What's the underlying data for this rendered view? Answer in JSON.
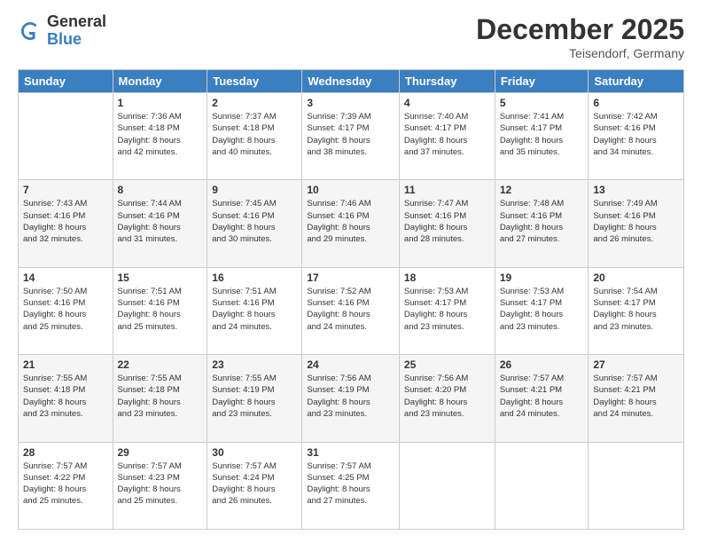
{
  "logo": {
    "general": "General",
    "blue": "Blue"
  },
  "header": {
    "month": "December 2025",
    "location": "Teisendorf, Germany"
  },
  "weekdays": [
    "Sunday",
    "Monday",
    "Tuesday",
    "Wednesday",
    "Thursday",
    "Friday",
    "Saturday"
  ],
  "weeks": [
    [
      {
        "day": "",
        "sunrise": "",
        "sunset": "",
        "daylight": ""
      },
      {
        "day": "1",
        "sunrise": "Sunrise: 7:36 AM",
        "sunset": "Sunset: 4:18 PM",
        "daylight": "Daylight: 8 hours and 42 minutes."
      },
      {
        "day": "2",
        "sunrise": "Sunrise: 7:37 AM",
        "sunset": "Sunset: 4:18 PM",
        "daylight": "Daylight: 8 hours and 40 minutes."
      },
      {
        "day": "3",
        "sunrise": "Sunrise: 7:39 AM",
        "sunset": "Sunset: 4:17 PM",
        "daylight": "Daylight: 8 hours and 38 minutes."
      },
      {
        "day": "4",
        "sunrise": "Sunrise: 7:40 AM",
        "sunset": "Sunset: 4:17 PM",
        "daylight": "Daylight: 8 hours and 37 minutes."
      },
      {
        "day": "5",
        "sunrise": "Sunrise: 7:41 AM",
        "sunset": "Sunset: 4:17 PM",
        "daylight": "Daylight: 8 hours and 35 minutes."
      },
      {
        "day": "6",
        "sunrise": "Sunrise: 7:42 AM",
        "sunset": "Sunset: 4:16 PM",
        "daylight": "Daylight: 8 hours and 34 minutes."
      }
    ],
    [
      {
        "day": "7",
        "sunrise": "Sunrise: 7:43 AM",
        "sunset": "Sunset: 4:16 PM",
        "daylight": "Daylight: 8 hours and 32 minutes."
      },
      {
        "day": "8",
        "sunrise": "Sunrise: 7:44 AM",
        "sunset": "Sunset: 4:16 PM",
        "daylight": "Daylight: 8 hours and 31 minutes."
      },
      {
        "day": "9",
        "sunrise": "Sunrise: 7:45 AM",
        "sunset": "Sunset: 4:16 PM",
        "daylight": "Daylight: 8 hours and 30 minutes."
      },
      {
        "day": "10",
        "sunrise": "Sunrise: 7:46 AM",
        "sunset": "Sunset: 4:16 PM",
        "daylight": "Daylight: 8 hours and 29 minutes."
      },
      {
        "day": "11",
        "sunrise": "Sunrise: 7:47 AM",
        "sunset": "Sunset: 4:16 PM",
        "daylight": "Daylight: 8 hours and 28 minutes."
      },
      {
        "day": "12",
        "sunrise": "Sunrise: 7:48 AM",
        "sunset": "Sunset: 4:16 PM",
        "daylight": "Daylight: 8 hours and 27 minutes."
      },
      {
        "day": "13",
        "sunrise": "Sunrise: 7:49 AM",
        "sunset": "Sunset: 4:16 PM",
        "daylight": "Daylight: 8 hours and 26 minutes."
      }
    ],
    [
      {
        "day": "14",
        "sunrise": "Sunrise: 7:50 AM",
        "sunset": "Sunset: 4:16 PM",
        "daylight": "Daylight: 8 hours and 25 minutes."
      },
      {
        "day": "15",
        "sunrise": "Sunrise: 7:51 AM",
        "sunset": "Sunset: 4:16 PM",
        "daylight": "Daylight: 8 hours and 25 minutes."
      },
      {
        "day": "16",
        "sunrise": "Sunrise: 7:51 AM",
        "sunset": "Sunset: 4:16 PM",
        "daylight": "Daylight: 8 hours and 24 minutes."
      },
      {
        "day": "17",
        "sunrise": "Sunrise: 7:52 AM",
        "sunset": "Sunset: 4:16 PM",
        "daylight": "Daylight: 8 hours and 24 minutes."
      },
      {
        "day": "18",
        "sunrise": "Sunrise: 7:53 AM",
        "sunset": "Sunset: 4:17 PM",
        "daylight": "Daylight: 8 hours and 23 minutes."
      },
      {
        "day": "19",
        "sunrise": "Sunrise: 7:53 AM",
        "sunset": "Sunset: 4:17 PM",
        "daylight": "Daylight: 8 hours and 23 minutes."
      },
      {
        "day": "20",
        "sunrise": "Sunrise: 7:54 AM",
        "sunset": "Sunset: 4:17 PM",
        "daylight": "Daylight: 8 hours and 23 minutes."
      }
    ],
    [
      {
        "day": "21",
        "sunrise": "Sunrise: 7:55 AM",
        "sunset": "Sunset: 4:18 PM",
        "daylight": "Daylight: 8 hours and 23 minutes."
      },
      {
        "day": "22",
        "sunrise": "Sunrise: 7:55 AM",
        "sunset": "Sunset: 4:18 PM",
        "daylight": "Daylight: 8 hours and 23 minutes."
      },
      {
        "day": "23",
        "sunrise": "Sunrise: 7:55 AM",
        "sunset": "Sunset: 4:19 PM",
        "daylight": "Daylight: 8 hours and 23 minutes."
      },
      {
        "day": "24",
        "sunrise": "Sunrise: 7:56 AM",
        "sunset": "Sunset: 4:19 PM",
        "daylight": "Daylight: 8 hours and 23 minutes."
      },
      {
        "day": "25",
        "sunrise": "Sunrise: 7:56 AM",
        "sunset": "Sunset: 4:20 PM",
        "daylight": "Daylight: 8 hours and 23 minutes."
      },
      {
        "day": "26",
        "sunrise": "Sunrise: 7:57 AM",
        "sunset": "Sunset: 4:21 PM",
        "daylight": "Daylight: 8 hours and 24 minutes."
      },
      {
        "day": "27",
        "sunrise": "Sunrise: 7:57 AM",
        "sunset": "Sunset: 4:21 PM",
        "daylight": "Daylight: 8 hours and 24 minutes."
      }
    ],
    [
      {
        "day": "28",
        "sunrise": "Sunrise: 7:57 AM",
        "sunset": "Sunset: 4:22 PM",
        "daylight": "Daylight: 8 hours and 25 minutes."
      },
      {
        "day": "29",
        "sunrise": "Sunrise: 7:57 AM",
        "sunset": "Sunset: 4:23 PM",
        "daylight": "Daylight: 8 hours and 25 minutes."
      },
      {
        "day": "30",
        "sunrise": "Sunrise: 7:57 AM",
        "sunset": "Sunset: 4:24 PM",
        "daylight": "Daylight: 8 hours and 26 minutes."
      },
      {
        "day": "31",
        "sunrise": "Sunrise: 7:57 AM",
        "sunset": "Sunset: 4:25 PM",
        "daylight": "Daylight: 8 hours and 27 minutes."
      },
      {
        "day": "",
        "sunrise": "",
        "sunset": "",
        "daylight": ""
      },
      {
        "day": "",
        "sunrise": "",
        "sunset": "",
        "daylight": ""
      },
      {
        "day": "",
        "sunrise": "",
        "sunset": "",
        "daylight": ""
      }
    ]
  ]
}
